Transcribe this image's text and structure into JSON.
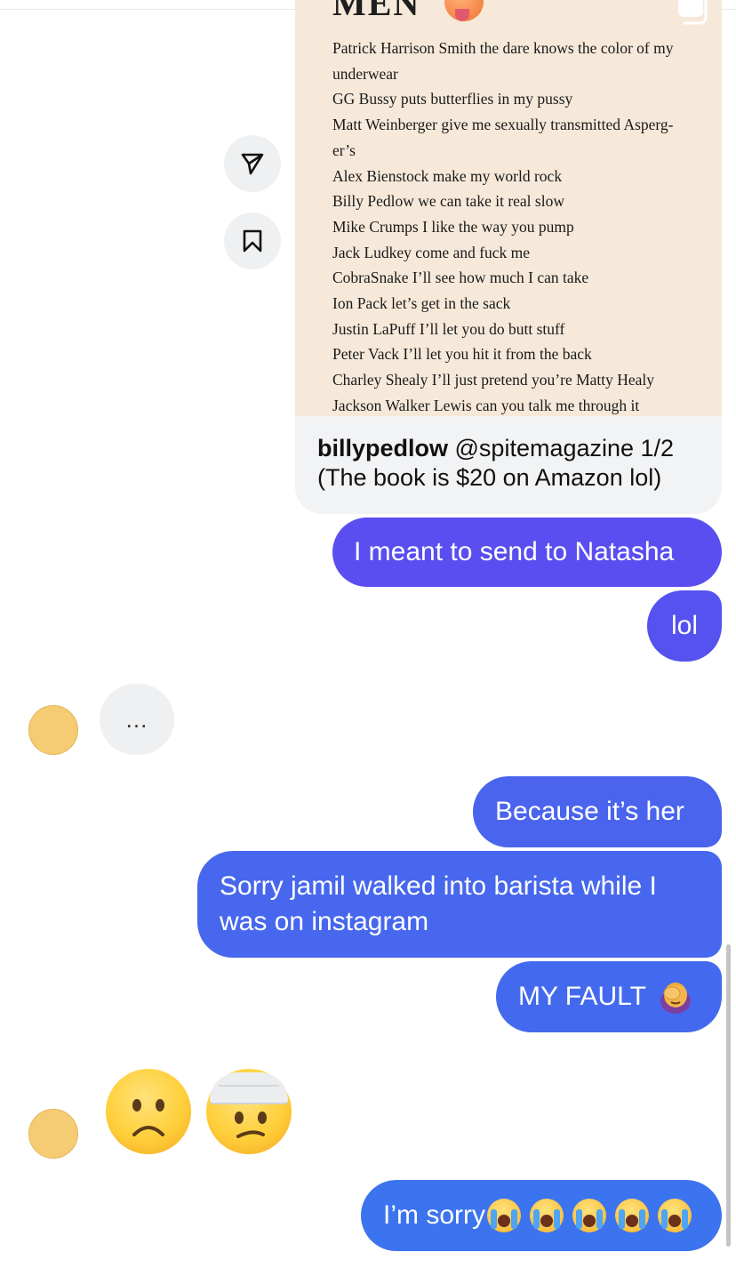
{
  "shared_post": {
    "image_heading": "MEN",
    "poem_lines": [
      "Patrick Harrison Smith the dare knows the color of my",
      "underwear",
      "GG Bussy puts butterflies in my pussy",
      "Matt Weinberger give me sexually transmitted Asperg-",
      "er’s",
      "Alex Bienstock make my world rock",
      "Billy Pedlow we can take it real slow",
      "Mike Crumps I like the way you pump",
      "Jack Ludkey come and fuck me",
      "CobraSnake I’ll see how much I can take",
      "Ion Pack let’s get in the sack",
      "Justin LaPuff I’ll let you do butt stuff",
      "Peter Vack I’ll let you hit it from the back",
      "Charley Shealy I’ll just pretend you’re Matty Healy",
      "Jackson Walker Lewis can you talk me through it"
    ],
    "caption_user": "billypedlow",
    "caption_text": " @spitemagazine 1/2 (The book is $20 on Amazon lol)"
  },
  "side_actions": {
    "share_icon": "paper-plane-icon",
    "save_icon": "bookmark-icon"
  },
  "messages": {
    "sent_1": "I meant to send to Natasha",
    "sent_2": "lol",
    "typing": "...",
    "sent_3": "Because it’s her",
    "sent_4": "Sorry jamil walked into barista while I was on instagram",
    "sent_5": "MY FAULT",
    "sent_5_emoji": "facepalm-emoji",
    "received_emojis": [
      "frowning-face-emoji",
      "head-bandage-emoji"
    ],
    "sent_6": "I’m sorry",
    "sent_6_emoji_count": 5
  },
  "colors": {
    "bubble_top": "#5a4ef1",
    "bubble_bottom": "#3c73ef",
    "avatar": "#f5cc74",
    "post_background": "#f6e9d9"
  }
}
